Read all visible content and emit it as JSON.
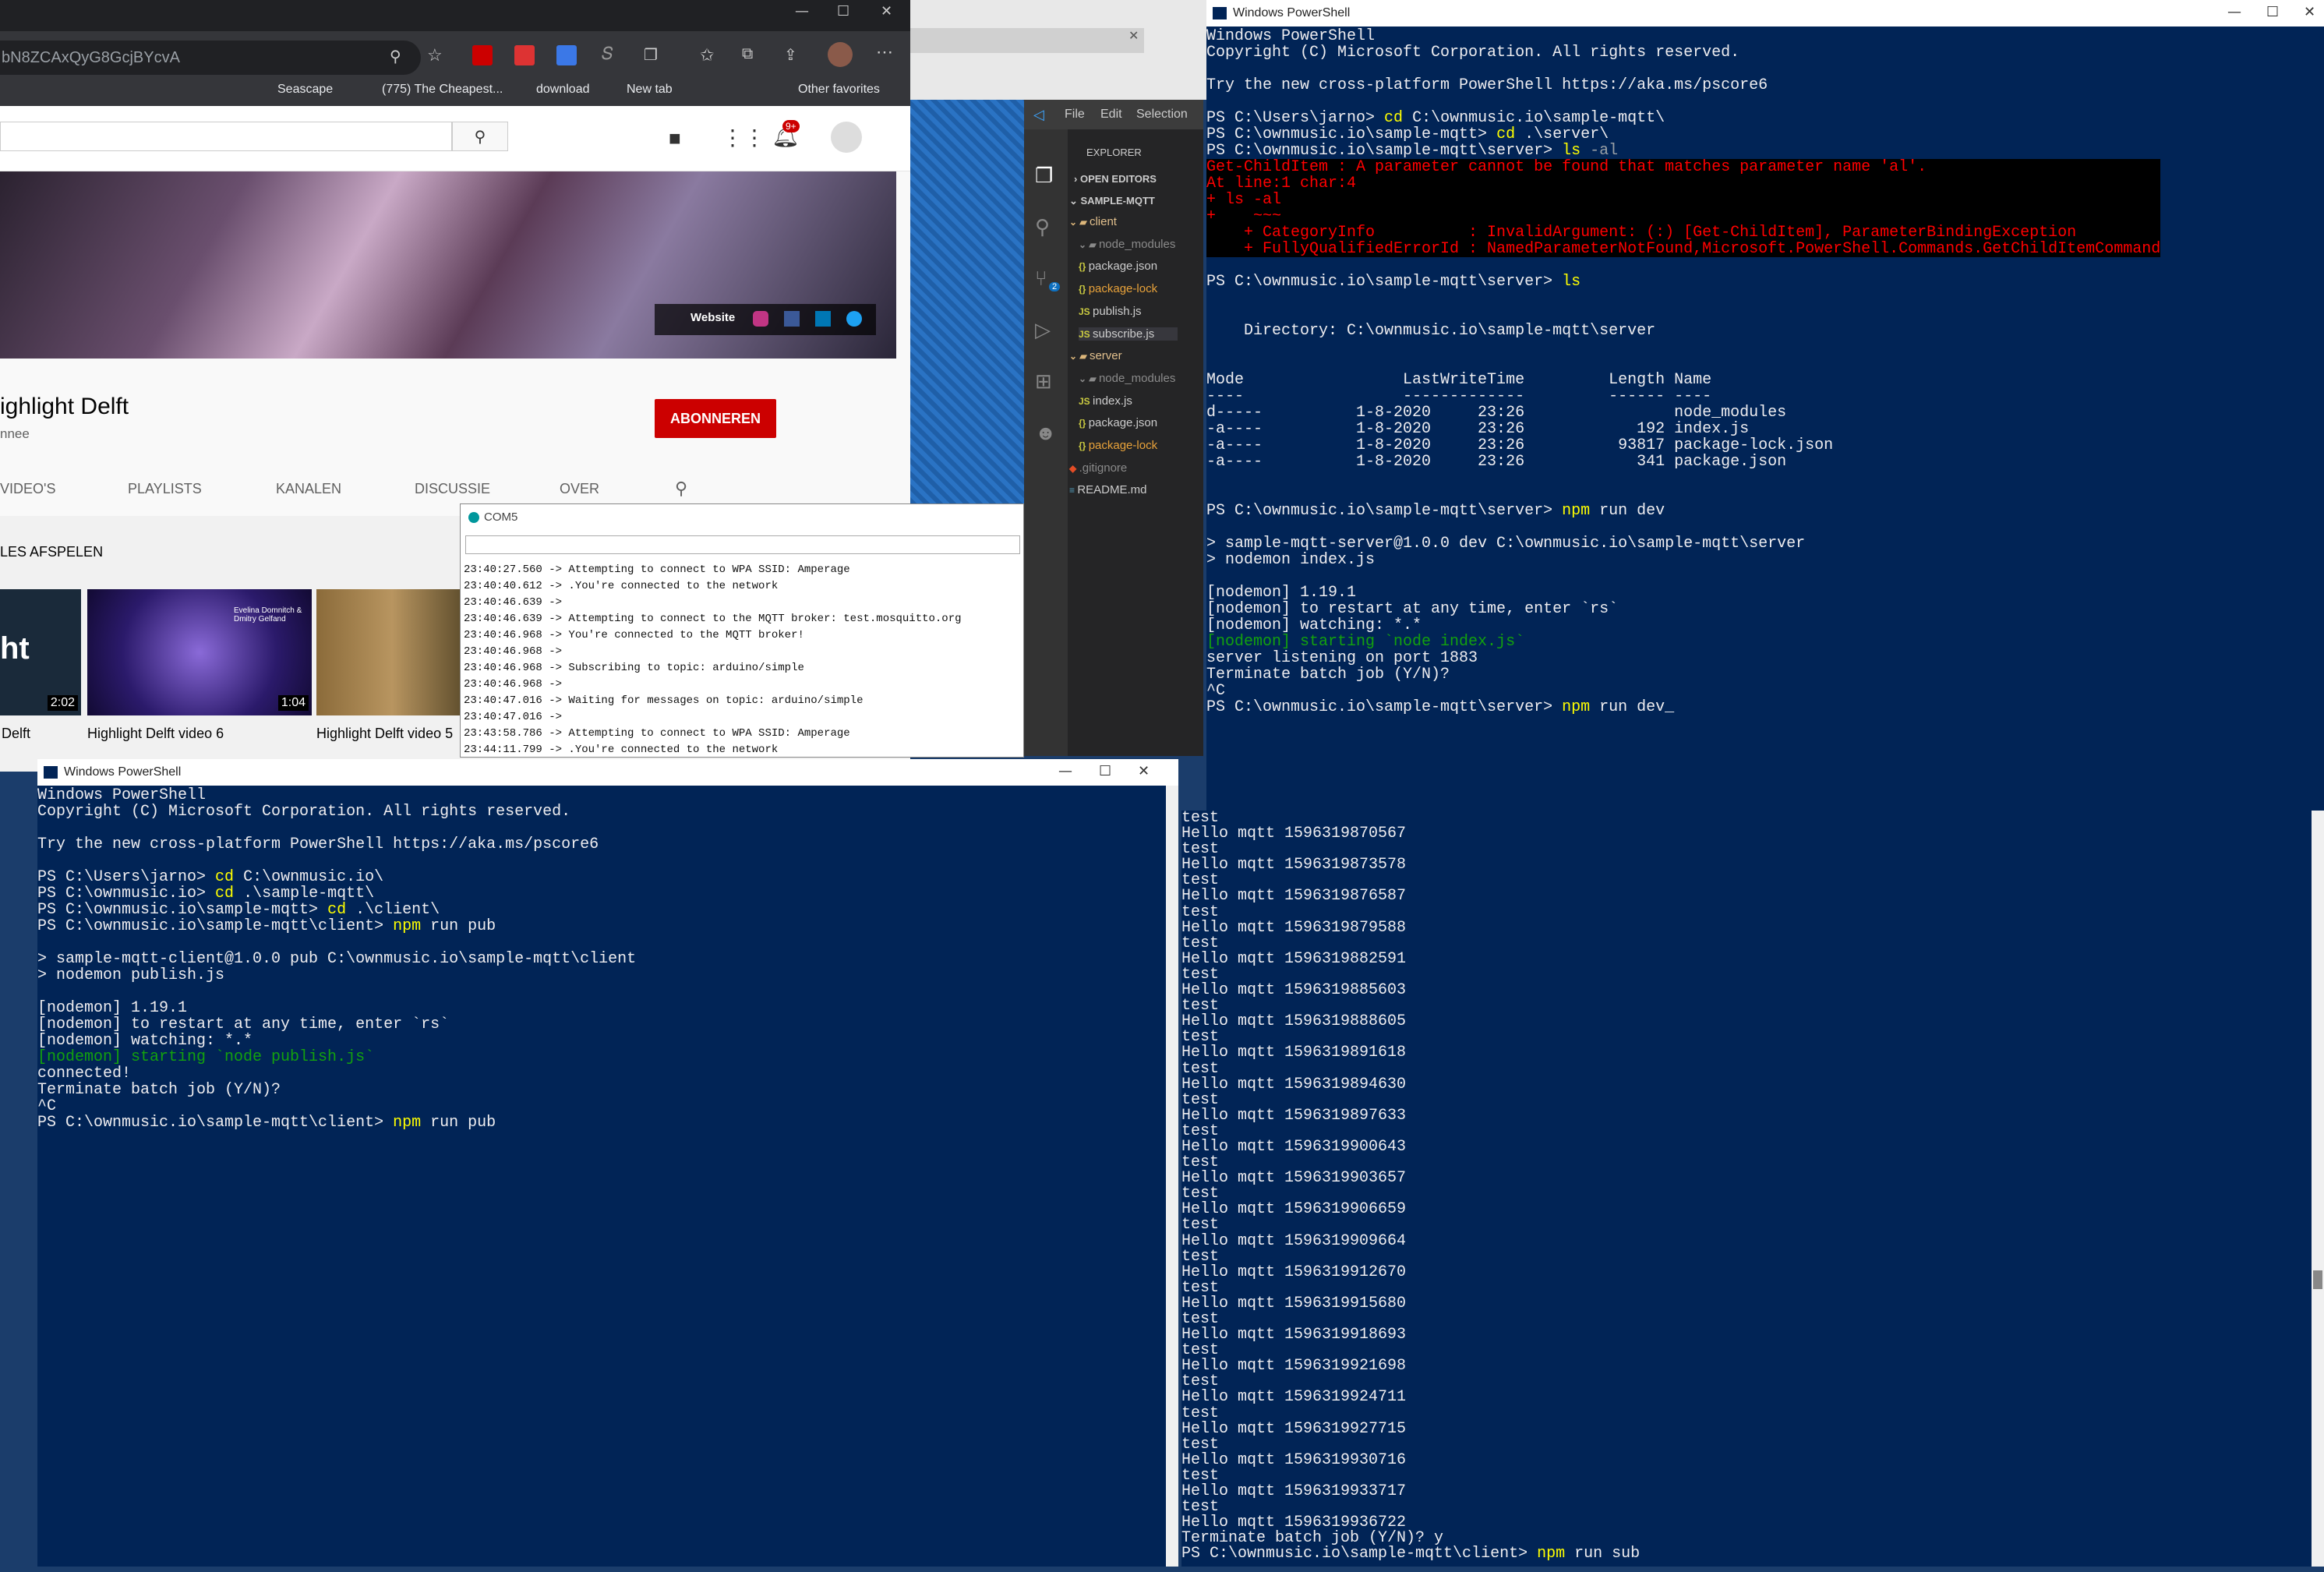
{
  "browser": {
    "url_fragment": "bN8ZCAxQyG8GcjBYcvA",
    "favorites": [
      "Seascape",
      "(775) The Cheapest...",
      "download",
      "New tab",
      "Other favorites"
    ],
    "notification_count": "9+",
    "banner_links": {
      "website": "Website"
    },
    "channel_name": "ighlight Delft",
    "channel_sub": "nnee",
    "subscribe_label": "ABONNEREN",
    "tabs": [
      "VIDEO'S",
      "PLAYLISTS",
      "KANALEN",
      "DISCUSSIE",
      "OVER"
    ],
    "section_title": "LES AFSPELEN",
    "videos": [
      {
        "title": "Delft",
        "duration": "2:02",
        "thumb_text": "ht"
      },
      {
        "title": "Highlight Delft video 6",
        "duration": "1:04",
        "thumb_text": "Evelina Domnitch & Dmitry Gelfand"
      },
      {
        "title": "Highlight Delft video 5",
        "duration": ""
      }
    ]
  },
  "com5": {
    "title": "COM5",
    "log": [
      "23:40:27.560 -> Attempting to connect to WPA SSID: Amperage",
      "23:40:40.612 -> .You're connected to the network",
      "23:40:46.639 ->",
      "23:40:46.639 -> Attempting to connect to the MQTT broker: test.mosquitto.org",
      "23:40:46.968 -> You're connected to the MQTT broker!",
      "23:40:46.968 ->",
      "23:40:46.968 -> Subscribing to topic: arduino/simple",
      "23:40:46.968 ->",
      "23:40:47.016 -> Waiting for messages on topic: arduino/simple",
      "23:40:47.016 ->",
      "23:43:58.786 -> Attempting to connect to WPA SSID: Amperage",
      "23:44:11.799 -> .You're connected to the network"
    ]
  },
  "vscode": {
    "menu": [
      "File",
      "Edit",
      "Selection"
    ],
    "explorer_label": "EXPLORER",
    "open_editors": "OPEN EDITORS",
    "project": "SAMPLE-MQTT",
    "scm_badge": "2",
    "tree": [
      {
        "label": "client",
        "kind": "folder"
      },
      {
        "label": "node_modules",
        "kind": "folder-dim"
      },
      {
        "label": "package.json",
        "kind": "json"
      },
      {
        "label": "package-lock",
        "kind": "json-dim"
      },
      {
        "label": "publish.js",
        "kind": "js"
      },
      {
        "label": "subscribe.js",
        "kind": "js-sel"
      },
      {
        "label": "server",
        "kind": "folder"
      },
      {
        "label": "node_modules",
        "kind": "folder-dim"
      },
      {
        "label": "index.js",
        "kind": "js"
      },
      {
        "label": "package.json",
        "kind": "json"
      },
      {
        "label": "package-lock",
        "kind": "json-dim"
      },
      {
        "label": ".gitignore",
        "kind": "git"
      },
      {
        "label": "README.md",
        "kind": "md"
      }
    ]
  },
  "ps_server": {
    "title": "Windows PowerShell",
    "lines": [
      "Windows PowerShell",
      "Copyright (C) Microsoft Corporation. All rights reserved.",
      "",
      "Try the new cross-platform PowerShell https://aka.ms/pscore6",
      "",
      "PS C:\\Users\\jarno> cd C:\\ownmusic.io\\sample-mqtt\\",
      "PS C:\\ownmusic.io\\sample-mqtt> cd .\\server\\",
      "PS C:\\ownmusic.io\\sample-mqtt\\server> ls -al",
      "Get-ChildItem : A parameter cannot be found that matches parameter name 'al'.",
      "At line:1 char:4",
      "+ ls -al",
      "+    ~~~",
      "    + CategoryInfo          : InvalidArgument: (:) [Get-ChildItem], ParameterBindingException",
      "    + FullyQualifiedErrorId : NamedParameterNotFound,Microsoft.PowerShell.Commands.GetChildItemCommand",
      "",
      "PS C:\\ownmusic.io\\sample-mqtt\\server> ls",
      "",
      "",
      "    Directory: C:\\ownmusic.io\\sample-mqtt\\server",
      "",
      "",
      "Mode                 LastWriteTime         Length Name",
      "----                 -------------         ------ ----",
      "d-----          1-8-2020     23:26                node_modules",
      "-a----          1-8-2020     23:26            192 index.js",
      "-a----          1-8-2020     23:26          93817 package-lock.json",
      "-a----          1-8-2020     23:26            341 package.json",
      "",
      "",
      "PS C:\\ownmusic.io\\sample-mqtt\\server> npm run dev",
      "",
      "> sample-mqtt-server@1.0.0 dev C:\\ownmusic.io\\sample-mqtt\\server",
      "> nodemon index.js",
      "",
      "[nodemon] 1.19.1",
      "[nodemon] to restart at any time, enter `rs`",
      "[nodemon] watching: *.*",
      "[nodemon] starting `node index.js`",
      "server listening on port 1883",
      "Terminate batch job (Y/N)?",
      "^C",
      "PS C:\\ownmusic.io\\sample-mqtt\\server> npm run dev_"
    ]
  },
  "ps_client": {
    "title": "Windows PowerShell",
    "lines": [
      "Windows PowerShell",
      "Copyright (C) Microsoft Corporation. All rights reserved.",
      "",
      "Try the new cross-platform PowerShell https://aka.ms/pscore6",
      "",
      "PS C:\\Users\\jarno> cd C:\\ownmusic.io\\",
      "PS C:\\ownmusic.io> cd .\\sample-mqtt\\",
      "PS C:\\ownmusic.io\\sample-mqtt> cd .\\client\\",
      "PS C:\\ownmusic.io\\sample-mqtt\\client> npm run pub",
      "",
      "> sample-mqtt-client@1.0.0 pub C:\\ownmusic.io\\sample-mqtt\\client",
      "> nodemon publish.js",
      "",
      "[nodemon] 1.19.1",
      "[nodemon] to restart at any time, enter `rs`",
      "[nodemon] watching: *.*",
      "[nodemon] starting `node publish.js`",
      "connected!",
      "Terminate batch job (Y/N)?",
      "^C",
      "PS C:\\ownmusic.io\\sample-mqtt\\client> npm run pub"
    ]
  },
  "ps_sub": {
    "lines": [
      "test",
      "Hello mqtt 1596319870567",
      "test",
      "Hello mqtt 1596319873578",
      "test",
      "Hello mqtt 1596319876587",
      "test",
      "Hello mqtt 1596319879588",
      "test",
      "Hello mqtt 1596319882591",
      "test",
      "Hello mqtt 1596319885603",
      "test",
      "Hello mqtt 1596319888605",
      "test",
      "Hello mqtt 1596319891618",
      "test",
      "Hello mqtt 1596319894630",
      "test",
      "Hello mqtt 1596319897633",
      "test",
      "Hello mqtt 1596319900643",
      "test",
      "Hello mqtt 1596319903657",
      "test",
      "Hello mqtt 1596319906659",
      "test",
      "Hello mqtt 1596319909664",
      "test",
      "Hello mqtt 1596319912670",
      "test",
      "Hello mqtt 1596319915680",
      "test",
      "Hello mqtt 1596319918693",
      "test",
      "Hello mqtt 1596319921698",
      "test",
      "Hello mqtt 1596319924711",
      "test",
      "Hello mqtt 1596319927715",
      "test",
      "Hello mqtt 1596319930716",
      "test",
      "Hello mqtt 1596319933717",
      "test",
      "Hello mqtt 1596319936722",
      "Terminate batch job (Y/N)? y",
      "PS C:\\ownmusic.io\\sample-mqtt\\client> npm run sub"
    ]
  },
  "colors": {
    "ps_bg": "#012456",
    "accent_red": "#cc0000",
    "prompt_yellow": "#ffff00"
  }
}
